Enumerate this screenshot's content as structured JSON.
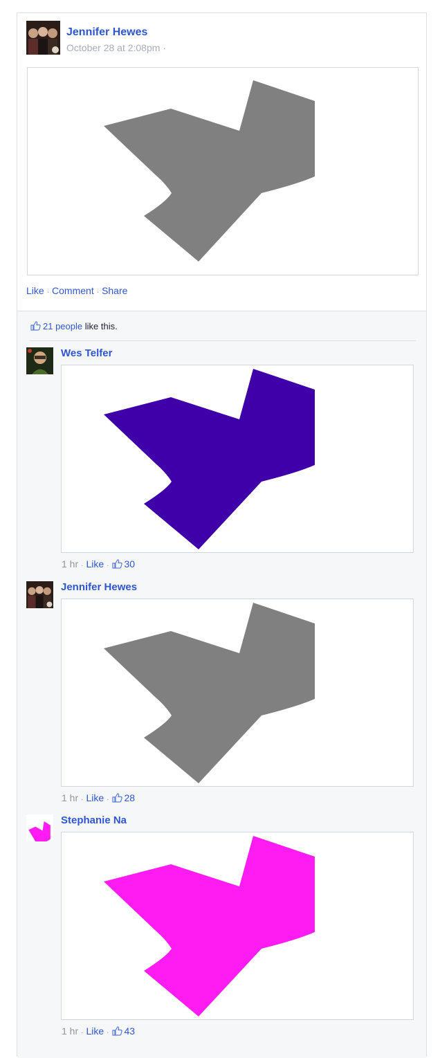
{
  "post": {
    "author": "Jennifer Hewes",
    "timestamp": "October 28 at 2:08pm",
    "timestamp_sep": "·",
    "shape_color": "#808080",
    "actions": {
      "like": "Like",
      "comment": "Comment",
      "share": "Share",
      "sep": "·"
    }
  },
  "likes": {
    "count_text": "21 people",
    "suffix": " like this."
  },
  "comments": [
    {
      "author": "Wes Telfer",
      "time": "1 hr",
      "like": "Like",
      "likes": "30",
      "shape_color": "#3f00aa",
      "sep": "·"
    },
    {
      "author": "Jennifer Hewes",
      "time": "1 hr",
      "like": "Like",
      "likes": "28",
      "shape_color": "#808080",
      "sep": "·"
    },
    {
      "author": "Stephanie Na",
      "time": "1 hr",
      "like": "Like",
      "likes": "43",
      "shape_color": "#ff1cf2",
      "sep": "·"
    }
  ],
  "colors": {
    "link": "#2f55d4",
    "muted": "#90949c",
    "feedback_bg": "#f6f7f9"
  }
}
